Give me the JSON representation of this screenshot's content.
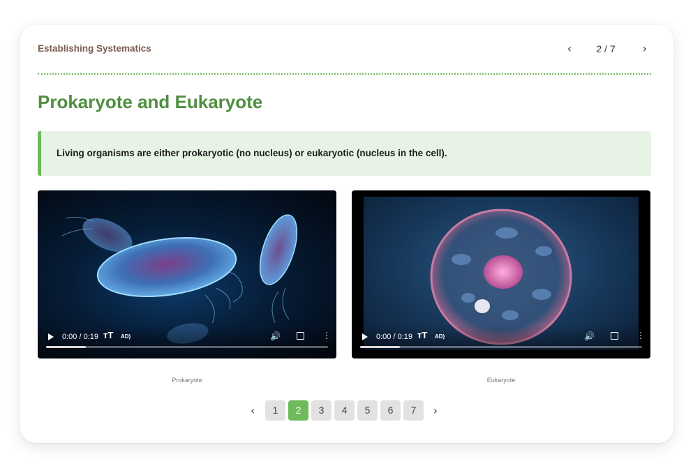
{
  "header": {
    "course_title": "Establishing Systematics",
    "prev_label": "‹",
    "page_counter": "2 / 7",
    "next_label": "›"
  },
  "page_title": "Prokaryote and Eukaryote",
  "callout": {
    "text": "Living organisms are either prokaryotic (no nucleus) or eukaryotic (nucleus in the cell)."
  },
  "videos": [
    {
      "caption": "Prokaryote",
      "time": "0:00 / 0:19",
      "cc_label": "ᴛT",
      "ad_label": "AD)",
      "progress": 0.14,
      "colors": {
        "cell": "#5ca8e8",
        "cell_inner": "#7a3f8a",
        "background": "#061c36"
      }
    },
    {
      "caption": "Eukaryote",
      "time": "0:00 / 0:19",
      "cc_label": "ᴛT",
      "ad_label": "AD)",
      "progress": 0.14,
      "colors": {
        "membrane": "#c5688f",
        "nucleus": "#e27fb8",
        "background": "#17375a"
      }
    }
  ],
  "pagination": {
    "prev_label": "‹",
    "next_label": "›",
    "pages": [
      "1",
      "2",
      "3",
      "4",
      "5",
      "6",
      "7"
    ],
    "current": "2"
  },
  "colors": {
    "accent": "#6dbb5a",
    "title_green": "#4f8f3f",
    "course_title": "#7a5c4e",
    "callout_bg": "#e7f3e4"
  }
}
